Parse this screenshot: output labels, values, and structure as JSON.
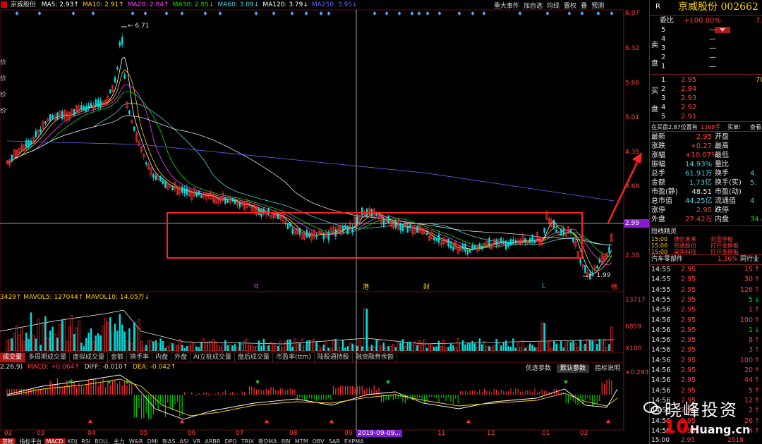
{
  "top_bar": {
    "stock_name": "京威股份",
    "ma_labels": [
      {
        "text": "MA5: 2.93↑",
        "color": "#ffffff"
      },
      {
        "text": "MA10: 2.91↑",
        "color": "#ffd200"
      },
      {
        "text": "MA20: 2.84↑",
        "color": "#ff40ff"
      },
      {
        "text": "MA30: 2.85↓",
        "color": "#00e600"
      },
      {
        "text": "MA60: 3.09↓",
        "color": "#4dd0e1"
      },
      {
        "text": "MA120: 3.79↓",
        "color": "#ffffff"
      },
      {
        "text": "MA250: 3.95↓",
        "color": "#6666ff"
      }
    ],
    "buttons": [
      "重大事件",
      "加自选",
      "均线",
      "置权",
      "叠",
      "预测"
    ]
  },
  "left_strip": [
    "价",
    "价",
    "价",
    "价"
  ],
  "price_axis": [
    "6.97",
    "6.32",
    "5.66",
    "5.01",
    "4.35",
    "3.69",
    "2.99",
    "2.38"
  ],
  "price_annotations": {
    "high": "6.71",
    "low": "1.99",
    "current_price_label": "2.99"
  },
  "event_markers": [
    "q",
    "港",
    "财",
    "L",
    "榜"
  ],
  "volume_panel": {
    "header": "3429↑  MAVOL5: 127044↑  MAVOL10: 14.05万↓",
    "axis": [
      "13717",
      "6859",
      "X100"
    ]
  },
  "indicator_tabs": [
    "成交量",
    "多周期成交量",
    "虚拟成交量",
    "金额",
    "换手率",
    "内盘",
    "外盘",
    "AI立桩成交量",
    "盘后成交量",
    "市盈率(ttm)",
    "陆股通持股",
    "融资融券余额"
  ],
  "macd_panel": {
    "header_left": "2,26,9)",
    "macd": "MACD: +0.064↑",
    "diff": "DIFF: -0.010↑",
    "dea": "DEA: -0.042↑",
    "buttons": [
      "优选参数",
      "默认参数",
      "指标说明"
    ],
    "axis": [
      "+0.293"
    ]
  },
  "x_axis": [
    "02",
    "03",
    "04",
    "05",
    "06",
    "07",
    "08",
    "09",
    "2019-09-09...",
    "11",
    "12",
    "01",
    "02"
  ],
  "bottom_tabs": [
    "指标平台",
    "MACD",
    "KDJ",
    "RSI",
    "BOLL",
    "主力",
    "W&R",
    "DMI",
    "BIAS",
    "ASI",
    "VR",
    "ARBR",
    "DPO",
    "TRIX",
    "新DMA",
    "BBI",
    "MTM",
    "OBV",
    "SAR",
    "EXPMA"
  ],
  "bottom_left_label": "京帐",
  "right_panel": {
    "r_label": "R",
    "title": "京威股份 002662",
    "weibi_label": "委比",
    "weibi_value": "+100.00%",
    "weibi_extra": "7.",
    "sell_label": "卖盘",
    "sell_levels": [
      {
        "n": "5",
        "p": "—",
        "v": ""
      },
      {
        "n": "4",
        "p": "—",
        "v": ""
      },
      {
        "n": "3",
        "p": "—",
        "v": ""
      },
      {
        "n": "2",
        "p": "—",
        "v": ""
      },
      {
        "n": "1",
        "p": "—",
        "v": ""
      }
    ],
    "buy_label": "买盘",
    "buy_levels": [
      {
        "n": "1",
        "p": "2.95",
        "v": "70"
      },
      {
        "n": "2",
        "p": "2.94",
        "v": ""
      },
      {
        "n": "3",
        "p": "2.93",
        "v": ""
      },
      {
        "n": "4",
        "p": "2.92",
        "v": ""
      },
      {
        "n": "5",
        "p": "2.91",
        "v": ""
      }
    ],
    "order_line": {
      "left": "在买盘2.87位置有",
      "qty": "1368手",
      "mid": "买单!",
      "right": "查看"
    },
    "stats": [
      {
        "l1": "最新",
        "v1": "2.95",
        "l2": "开盘",
        "v2": ""
      },
      {
        "l1": "涨跌",
        "v1": "+0.27",
        "l2": "最高",
        "v2": ""
      },
      {
        "l1": "涨幅",
        "v1": "+10.07%",
        "l2": "最低",
        "v2": ""
      },
      {
        "l1": "振幅",
        "v1": "14.93%",
        "l2": "量比",
        "v2": ""
      },
      {
        "l1": "总手",
        "v1": "61.91万",
        "l2": "换手",
        "v2": "4."
      },
      {
        "l1": "金额",
        "v1": "1.73亿",
        "l2": "换手(实)",
        "v2": "5."
      },
      {
        "l1": "市盈(静)",
        "v1": "48.51",
        "l2": "市盈(动)",
        "v2": ""
      },
      {
        "l1": "总市值",
        "v1": "44.25亿",
        "l2": "流通值",
        "v2": "4"
      },
      {
        "l1": "涨停",
        "v1": "2.95",
        "l2": "跌停",
        "v2": ""
      },
      {
        "l1": "外盘",
        "v1": "27.42万",
        "l2": "内盘",
        "v2": "34.4"
      }
    ],
    "elves_title": "短线精灵",
    "elves": [
      {
        "t": "15:00",
        "name": "德尔未来",
        "ev": "封涨停板"
      },
      {
        "t": "15:00",
        "name": "兆驰股份",
        "ev": "打开涨停板"
      },
      {
        "t": "15:00",
        "name": "昊华科技",
        "ev": "打开涨停板"
      }
    ],
    "sector": {
      "name": "汽车零部件",
      "pct": "1.36%",
      "right": "同行业"
    },
    "ticks": [
      {
        "t": "14:55",
        "p": "2.95",
        "v": "15",
        "d": "up"
      },
      {
        "t": "14:55",
        "p": "2.95",
        "v": "30",
        "d": "up"
      },
      {
        "t": "14:55",
        "p": "2.95",
        "v": "126",
        "d": "up"
      },
      {
        "t": "14:55",
        "p": "2.95",
        "v": "5",
        "d": "down"
      },
      {
        "t": "14:56",
        "p": "2.95",
        "v": "1",
        "d": "up"
      },
      {
        "t": "14:56",
        "p": "2.95",
        "v": "100",
        "d": "up"
      },
      {
        "t": "14:56",
        "p": "2.95",
        "v": "1",
        "d": "down"
      },
      {
        "t": "14:56",
        "p": "2.95",
        "v": "8",
        "d": "up"
      },
      {
        "t": "14:56",
        "p": "2.95",
        "v": "3",
        "d": "up"
      },
      {
        "t": "14:56",
        "p": "2.95",
        "v": "100",
        "d": "up"
      },
      {
        "t": "14:56",
        "p": "2.95",
        "v": "20",
        "d": "up"
      },
      {
        "t": "14:56",
        "p": "2.95",
        "v": "44",
        "d": "up"
      },
      {
        "t": "14:56",
        "p": "2.95",
        "v": "5",
        "d": "up"
      },
      {
        "t": "14:56",
        "p": "2.95",
        "v": "12",
        "d": "up"
      },
      {
        "t": "14:56",
        "p": "2.95",
        "v": "2",
        "d": "up"
      },
      {
        "t": "14:56",
        "p": "2.95",
        "v": "26",
        "d": "up"
      },
      {
        "t": "14:56",
        "p": "2.95",
        "v": "4",
        "d": "up"
      }
    ],
    "last_tick_partial": {
      "t": "15:00",
      "p": "2.95",
      "v": "2518"
    }
  },
  "watermark": {
    "brand": "晓峰投资",
    "site": "Huang.cn"
  },
  "colors": {
    "up": "#ff3030",
    "down": "#00e0e0",
    "highlight_box": "#ff2020",
    "accent_red": "#b01818"
  }
}
